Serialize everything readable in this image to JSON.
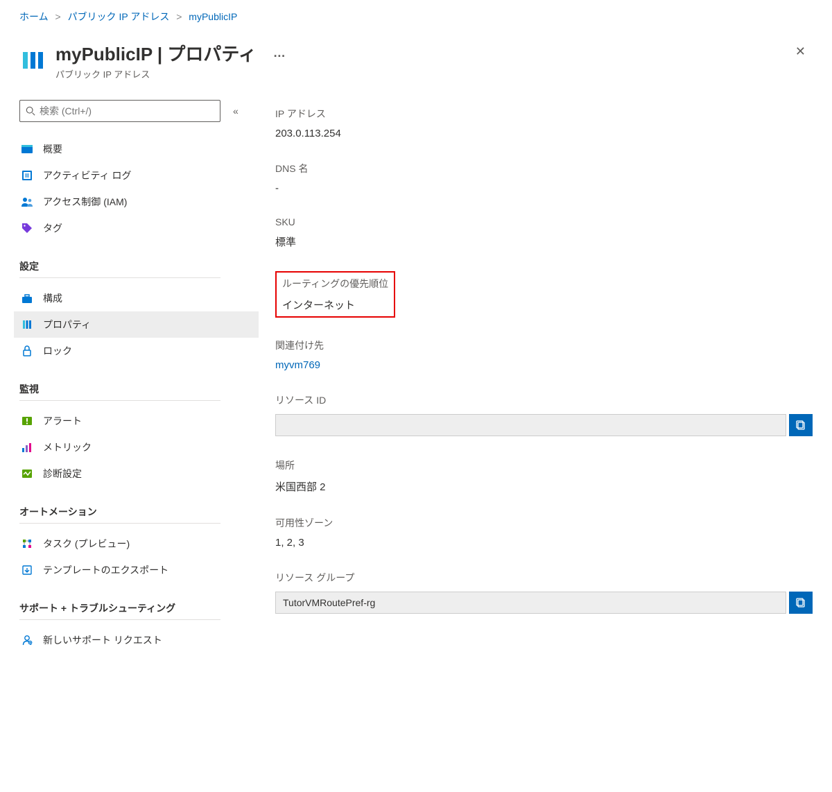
{
  "breadcrumb": {
    "home": "ホーム",
    "parent": "パブリック IP アドレス",
    "current": "myPublicIP"
  },
  "header": {
    "title": "myPublicIP | プロパティ",
    "subtitle": "パブリック IP アドレス"
  },
  "search": {
    "placeholder": "検索 (Ctrl+/)"
  },
  "nav": {
    "overview": "概要",
    "activity_log": "アクティビティ ログ",
    "iam": "アクセス制御 (IAM)",
    "tags": "タグ",
    "section_settings": "設定",
    "configuration": "構成",
    "properties": "プロパティ",
    "locks": "ロック",
    "section_monitoring": "監視",
    "alerts": "アラート",
    "metrics": "メトリック",
    "diagnostic": "診断設定",
    "section_automation": "オートメーション",
    "tasks": "タスク (プレビュー)",
    "export_template": "テンプレートのエクスポート",
    "section_support": "サポート + トラブルシューティング",
    "new_support": "新しいサポート リクエスト"
  },
  "props": {
    "ip_label": "IP アドレス",
    "ip_value": "203.0.113.254",
    "dns_label": "DNS 名",
    "dns_value": "-",
    "sku_label": "SKU",
    "sku_value": "標準",
    "routing_pref_label": "ルーティングの優先順位",
    "routing_pref_value": "インターネット",
    "associated_label": "関連付け先",
    "associated_value": "myvm769",
    "resource_id_label": "リソース ID",
    "resource_id_value": "",
    "location_label": "場所",
    "location_value": "米国西部 2",
    "availability_zone_label": "可用性ゾーン",
    "availability_zone_value": "1, 2, 3",
    "resource_group_label": "リソース グループ",
    "resource_group_value": "TutorVMRoutePref-rg"
  }
}
